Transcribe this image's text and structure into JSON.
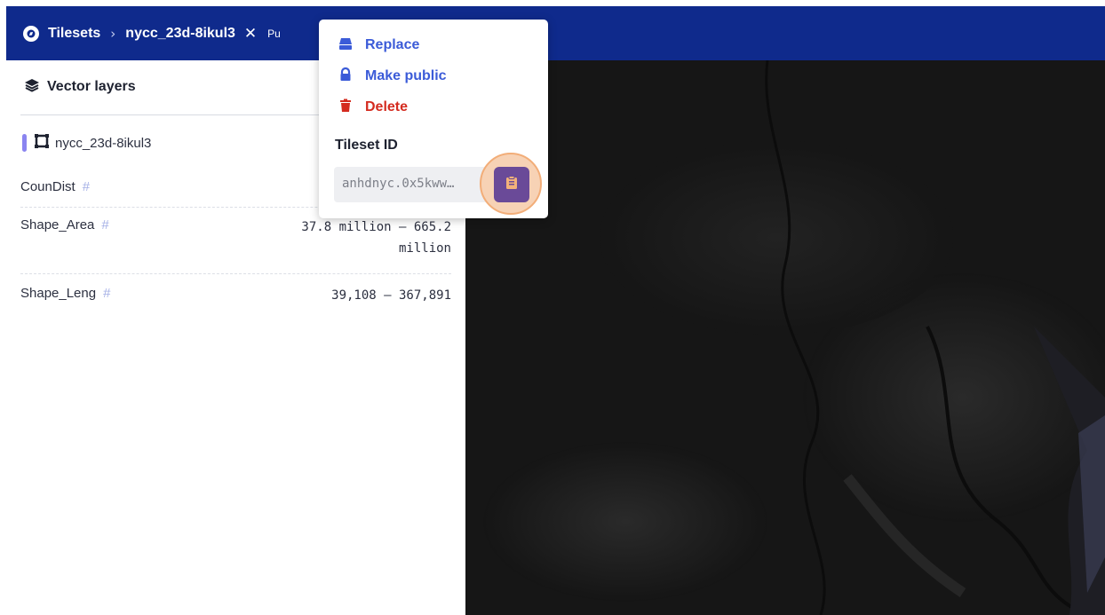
{
  "topbar": {
    "breadcrumb_root": "Tilesets",
    "breadcrumb_current": "nycc_23d-8ikul3",
    "badge": "Pu",
    "bg_color": "#0f2a8c"
  },
  "sidebar": {
    "title": "Vector layers",
    "layer_name": "nycc_23d-8ikul3",
    "layer_color": "#8a84f0",
    "fields": [
      {
        "name": "CounDist",
        "type_symbol": "#",
        "range_line1": "",
        "range_line2": ""
      },
      {
        "name": "Shape_Area",
        "type_symbol": "#",
        "range_line1": "37.8 million – 665.2",
        "range_line2": "million"
      },
      {
        "name": "Shape_Leng",
        "type_symbol": "#",
        "range_line1": "39,108 – 367,891",
        "range_line2": ""
      }
    ]
  },
  "menu": {
    "items": [
      {
        "label": "Replace",
        "icon": "hard-drive-icon",
        "color": "#3b5bd8"
      },
      {
        "label": "Make public",
        "icon": "lock-icon",
        "color": "#3b5bd8"
      },
      {
        "label": "Delete",
        "icon": "trash-icon",
        "color": "#d42b1f"
      }
    ],
    "tileset_id_label": "Tileset ID",
    "tileset_id_value": "anhdnyc.0x5kww…",
    "copy_icon": "clipboard-icon"
  }
}
